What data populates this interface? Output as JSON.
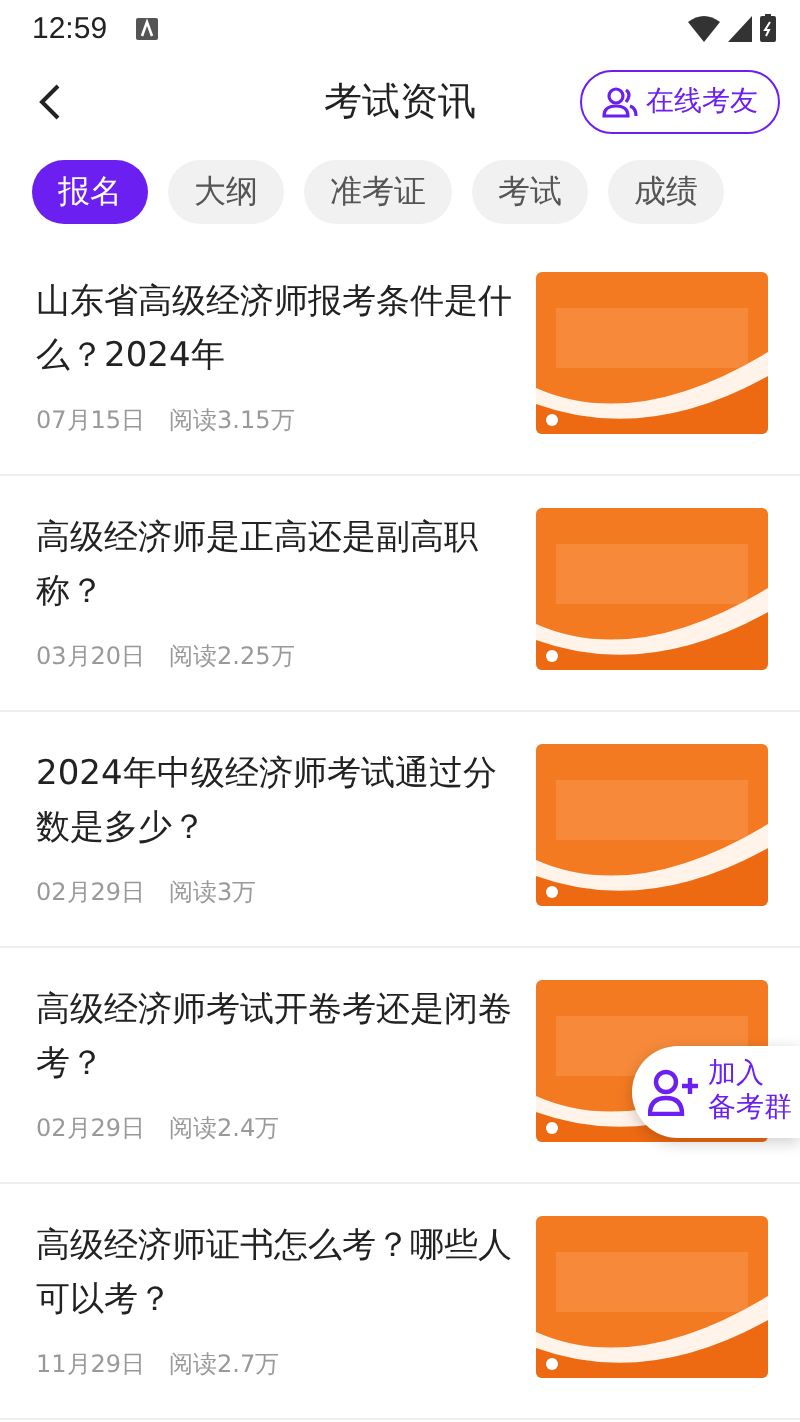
{
  "status_bar": {
    "time": "12:59"
  },
  "header": {
    "title": "考试资讯",
    "action": "在线考友"
  },
  "tabs": [
    {
      "label": "报名",
      "selected": true
    },
    {
      "label": "大纲",
      "selected": false
    },
    {
      "label": "准考证",
      "selected": false
    },
    {
      "label": "考试",
      "selected": false
    },
    {
      "label": "成绩",
      "selected": false
    }
  ],
  "articles": [
    {
      "title": "山东省高级经济师报考条件是什么？2024年",
      "date": "07月15日",
      "reads": "阅读3.15万"
    },
    {
      "title": "高级经济师是正高还是副高职称？",
      "date": "03月20日",
      "reads": "阅读2.25万"
    },
    {
      "title": "2024年中级经济师考试通过分数是多少？",
      "date": "02月29日",
      "reads": "阅读3万"
    },
    {
      "title": "高级经济师考试开卷考还是闭卷考？",
      "date": "02月29日",
      "reads": "阅读2.4万"
    },
    {
      "title": "高级经济师证书怎么考？哪些人可以考？",
      "date": "11月29日",
      "reads": "阅读2.7万"
    }
  ],
  "floating_button": {
    "line_1": "加入",
    "line_2": "备考群"
  }
}
